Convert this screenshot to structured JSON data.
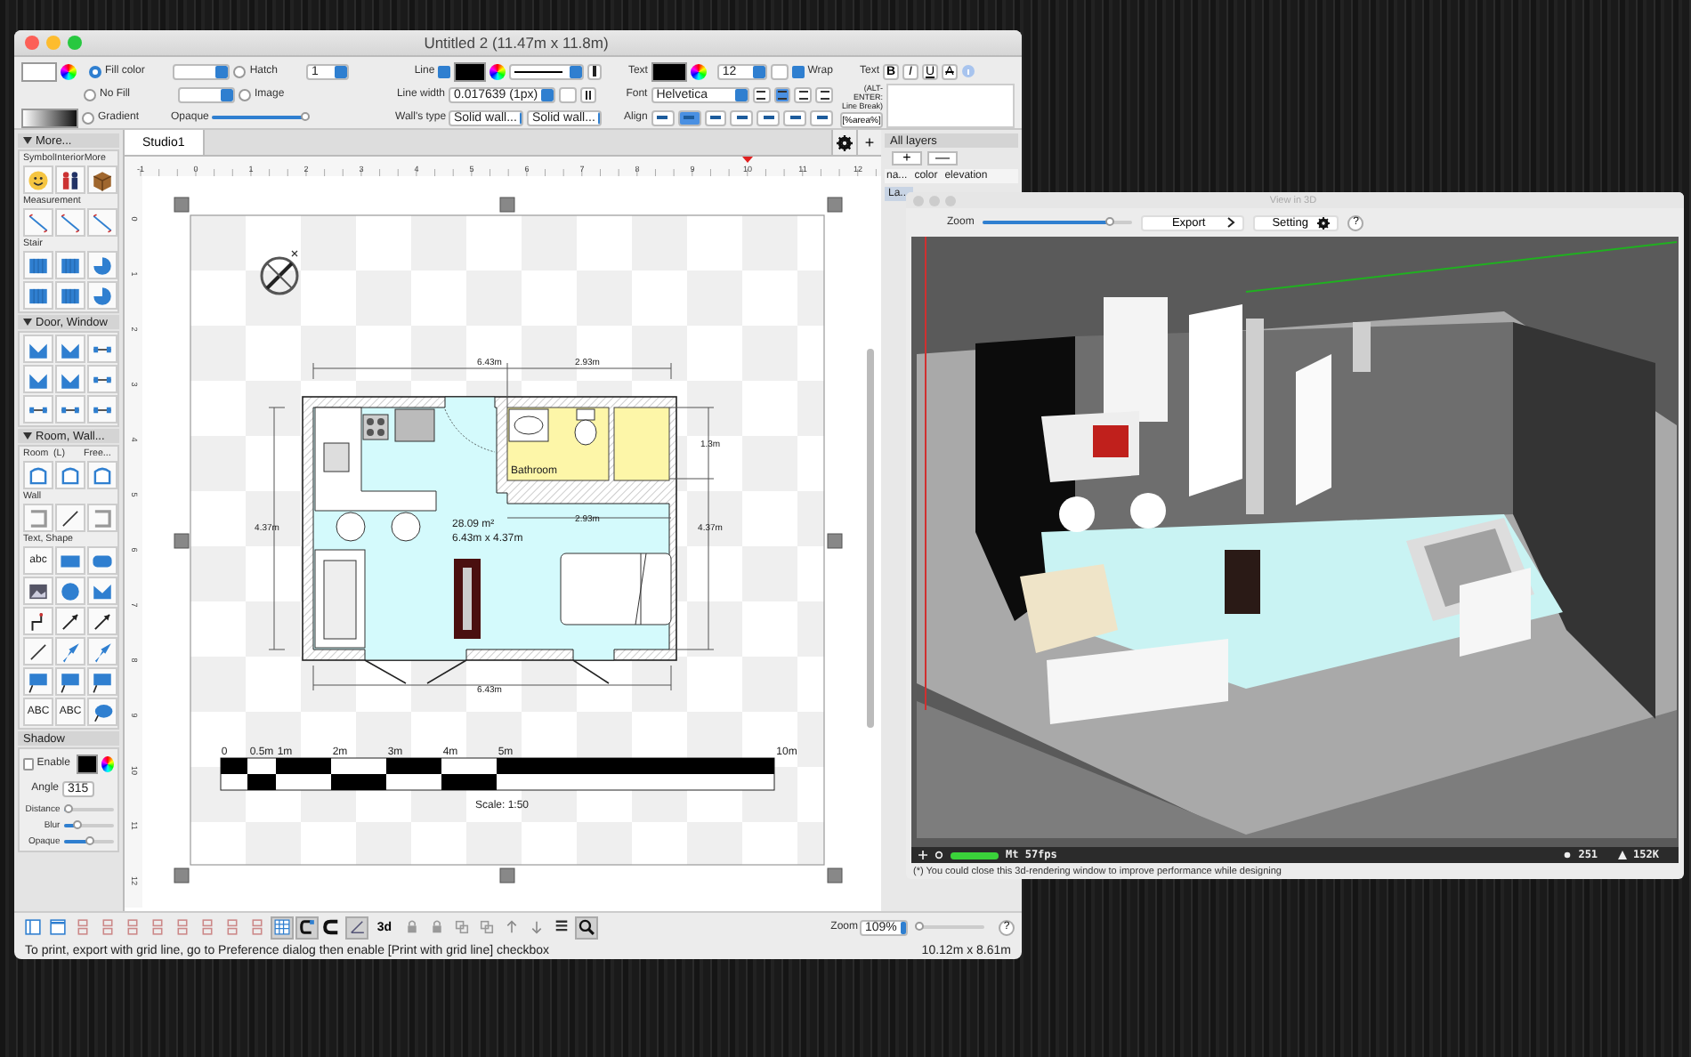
{
  "main_window": {
    "title": "Untitled 2 (11.47m x 11.8m)"
  },
  "fill_panel": {
    "fill_modes": [
      {
        "label": "Fill color",
        "selected": true
      },
      {
        "label": "No Fill",
        "selected": false
      },
      {
        "label": "Gradient",
        "selected": false
      }
    ],
    "pattern_modes": [
      {
        "label": "Hatch",
        "selected": false
      },
      {
        "label": "Image",
        "selected": false
      }
    ],
    "hatch_scale": "1",
    "opaque": {
      "label": "Opaque",
      "level": 0.95
    }
  },
  "line_panel": {
    "line": {
      "label": "Line",
      "checked": true
    },
    "width": {
      "label": "Line width",
      "value": "0.017639 (1px)"
    },
    "walls_type": {
      "label": "Wall's type",
      "values": [
        "Solid wall...",
        "Solid wall..."
      ]
    }
  },
  "text_panel": {
    "label": "Text",
    "size": "12",
    "wrap": {
      "label": "Wrap",
      "checked": true
    },
    "font": {
      "label": "Font",
      "value": "Helvetica"
    },
    "h_align": [
      {
        "selected": false
      },
      {
        "selected": true
      },
      {
        "selected": false
      },
      {
        "selected": false
      }
    ],
    "align_label": "Align",
    "v_align": [
      {
        "selected": false
      },
      {
        "selected": true
      },
      {
        "selected": false
      },
      {
        "selected": false
      },
      {
        "selected": false
      },
      {
        "selected": false
      },
      {
        "selected": false
      }
    ]
  },
  "style_panel": {
    "label": "Text",
    "buttons": [
      {
        "text": "B",
        "kind": "bold"
      },
      {
        "text": "I",
        "kind": "italic"
      },
      {
        "text": "U",
        "kind": "underline"
      },
      {
        "text": "A",
        "kind": "strike"
      }
    ],
    "hint": "(ALT-ENTER: Line Break)",
    "token_button": "[%area%]"
  },
  "palette": {
    "sections": [
      {
        "title": "More...",
        "groups": [
          {
            "labels": [
              "Symbol",
              "Interior",
              "More"
            ],
            "tools": [
              {
                "kind": "smiley"
              },
              {
                "kind": "people"
              },
              {
                "kind": "box"
              }
            ]
          },
          {
            "labels": [
              "Measurement"
            ],
            "tools": [
              {
                "kind": "measure"
              },
              {
                "kind": "measure"
              },
              {
                "kind": "measure"
              }
            ]
          },
          {
            "labels": [
              "Stair"
            ],
            "tools": [
              {
                "kind": "stair"
              },
              {
                "kind": "stair"
              },
              {
                "kind": "spiral"
              },
              {
                "kind": "stair"
              },
              {
                "kind": "stair"
              },
              {
                "kind": "spiral"
              }
            ]
          }
        ]
      },
      {
        "title": "Door, Window",
        "groups": [
          {
            "tools": [
              {
                "kind": "door"
              },
              {
                "kind": "door"
              },
              {
                "kind": "window"
              },
              {
                "kind": "door"
              },
              {
                "kind": "door"
              },
              {
                "kind": "window"
              },
              {
                "kind": "window"
              },
              {
                "kind": "window"
              },
              {
                "kind": "window"
              }
            ]
          }
        ]
      },
      {
        "title": "Room, Wall...",
        "groups": [
          {
            "labels": [
              "Room",
              "(L)",
              "Free..."
            ],
            "tools": [
              {
                "kind": "room"
              },
              {
                "kind": "room"
              },
              {
                "kind": "room"
              }
            ]
          },
          {
            "labels": [
              "Wall"
            ],
            "tools": [
              {
                "kind": "wall"
              },
              {
                "kind": "line"
              },
              {
                "kind": "wall"
              }
            ]
          },
          {
            "labels": [
              "Text, Shape"
            ],
            "tools": [
              {
                "kind": "text",
                "text": "abc"
              },
              {
                "kind": "rect"
              },
              {
                "kind": "roundrect"
              },
              {
                "kind": "image"
              },
              {
                "kind": "circle"
              },
              {
                "kind": "shape"
              },
              {
                "kind": "elbow"
              },
              {
                "kind": "arrow"
              },
              {
                "kind": "arrow"
              },
              {
                "kind": "line"
              },
              {
                "kind": "fatarrow"
              },
              {
                "kind": "fatarrow"
              },
              {
                "kind": "callout"
              },
              {
                "kind": "callout"
              },
              {
                "kind": "callout"
              },
              {
                "kind": "text",
                "text": "ABC"
              },
              {
                "kind": "text",
                "text": "ABC"
              },
              {
                "kind": "ellipse"
              }
            ]
          }
        ]
      }
    ],
    "shadow": {
      "title": "Shadow",
      "enable": {
        "label": "Enable",
        "checked": false
      },
      "angle": {
        "label": "Angle",
        "value": "315"
      },
      "sliders": [
        {
          "label": "Distance",
          "level": 0.1
        },
        {
          "label": "Blur",
          "level": 0.3
        },
        {
          "label": "Opaque",
          "level": 0.55
        }
      ]
    }
  },
  "canvas": {
    "tabs": [
      {
        "label": "Studio1",
        "selected": true
      }
    ],
    "add_tab": "+",
    "top_ruler": [
      "-1",
      "0",
      "1",
      "2",
      "3",
      "4",
      "5",
      "6",
      "7",
      "8",
      "9",
      "10",
      "11",
      "12"
    ],
    "left_ruler": [
      "0",
      "1",
      "2",
      "3",
      "4",
      "5",
      "6",
      "7",
      "8",
      "9",
      "10",
      "11",
      "12"
    ],
    "plan": {
      "dimension_labels": [
        "6.43m",
        "2.93m",
        "4.37m",
        "1.3m",
        "4.37m",
        "2.93m",
        "6.43m"
      ],
      "room_area": "28.09 m²",
      "room_size": "6.43m x 4.37m",
      "room_name": "Bathroom"
    },
    "scale_bar": {
      "marks": [
        "0",
        "0.5m",
        "1m",
        "2m",
        "3m",
        "4m",
        "5m",
        "10m"
      ],
      "caption": "Scale: 1:50"
    }
  },
  "layers": {
    "title": "All layers",
    "buttons": [
      "+",
      "—"
    ],
    "columns": [
      "na...",
      "color",
      "elevation"
    ],
    "rows": [
      {
        "name": "La...",
        "selected": true
      }
    ]
  },
  "bottom_bar": {
    "tools": [
      {
        "kind": "sidebar",
        "selected": false
      },
      {
        "kind": "window",
        "selected": false
      },
      {
        "kind": "split",
        "selected": false
      },
      {
        "kind": "split",
        "selected": false
      },
      {
        "kind": "split",
        "selected": false
      },
      {
        "kind": "split",
        "selected": false
      },
      {
        "kind": "split",
        "selected": false
      },
      {
        "kind": "split",
        "selected": false
      },
      {
        "kind": "split",
        "selected": false
      },
      {
        "kind": "split",
        "selected": false
      },
      {
        "kind": "grid",
        "selected": true
      },
      {
        "kind": "snap",
        "selected": true
      },
      {
        "kind": "magnet",
        "selected": false
      },
      {
        "kind": "angle",
        "selected": true
      },
      {
        "kind": "text",
        "text": "3d",
        "selected": false
      },
      {
        "kind": "lock",
        "selected": false
      },
      {
        "kind": "lock",
        "selected": false
      },
      {
        "kind": "group",
        "selected": false
      },
      {
        "kind": "group",
        "selected": false
      },
      {
        "kind": "up",
        "selected": false
      },
      {
        "kind": "down",
        "selected": false
      },
      {
        "kind": "fit",
        "selected": false
      },
      {
        "kind": "zoom",
        "selected": true
      }
    ],
    "zoom": {
      "label": "Zoom",
      "value": "109%",
      "level": 0.05
    },
    "help": "?",
    "status": "To print, export with grid line, go to Preference dialog then enable [Print with grid line] checkbox",
    "size": "10.12m x 8.61m"
  },
  "view3d": {
    "title": "View in 3D",
    "zoom": {
      "label": "Zoom",
      "level": 0.85
    },
    "buttons": [
      {
        "label": "Export",
        "kind": "menu"
      },
      {
        "label": "Setting",
        "kind": "settings"
      }
    ],
    "help": "?",
    "fps": {
      "level": 1,
      "text": "Mt 57fps"
    },
    "stats": [
      {
        "kind": "points",
        "text": "251"
      },
      {
        "kind": "triangles",
        "text": "152K"
      }
    ],
    "note": "(*) You could close this 3d-rendering window to improve performance while designing"
  }
}
